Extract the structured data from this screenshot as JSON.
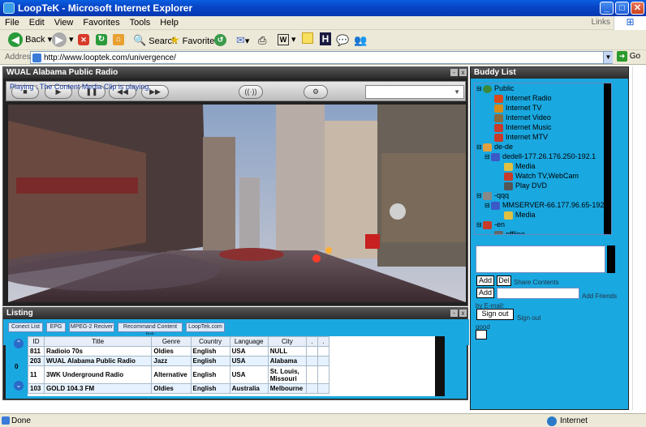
{
  "window": {
    "title": "LoopTeK - Microsoft Internet Explorer"
  },
  "menu": [
    "File",
    "Edit",
    "View",
    "Favorites",
    "Tools",
    "Help"
  ],
  "menu_links": "Links",
  "toolbar": {
    "back": "Back",
    "search": "Search",
    "favorites": "Favorites"
  },
  "address": {
    "label": "Address",
    "url": "http://www.looptek.com/univergence/",
    "go": "Go"
  },
  "player": {
    "title": "WUAL Alabama Public Radio",
    "status_text": "Playing : The Content Media Clip is playing."
  },
  "listing": {
    "title": "Listing",
    "tabs": [
      "Conect List",
      "EPG",
      "MPEG-2 Reciver",
      "Recommand Content link",
      "LoopTek.com"
    ],
    "page_indicator": "0",
    "columns": [
      "ID",
      "Title",
      "Genre",
      "Country",
      "Language",
      "City",
      ".",
      "."
    ],
    "rows": [
      [
        "811",
        "Radioio 70s",
        "Oldies",
        "English",
        "USA",
        "NULL"
      ],
      [
        "203",
        "WUAL Alabama Public Radio",
        "Jazz",
        "English",
        "USA",
        "Alabama"
      ],
      [
        "11",
        "3WK Underground Radio",
        "Alternative",
        "English",
        "USA",
        "St. Louis, Missouri"
      ],
      [
        "103",
        "GOLD 104.3 FM",
        "Oldies",
        "English",
        "Australia",
        "Melbourne"
      ]
    ]
  },
  "buddy": {
    "title": "Buddy List",
    "tree": {
      "public": "Public",
      "public_items": [
        "Internet Radio",
        "Internet TV",
        "Internet Video",
        "Internet Music",
        "Internet MTV"
      ],
      "dede": "de-de",
      "dede_host": "dedell-177.26.176.250-192.1",
      "dede_items": [
        "Media",
        "Watch TV,WebCam",
        "Play DVD"
      ],
      "qqq": "-qqq",
      "qqq_host": "MMSERVER-66.177.96.65-192",
      "qqq_items": [
        "Media"
      ],
      "en": "-en",
      "offline": "offline"
    },
    "add": "Add",
    "del": "Del",
    "share_contents": "Share Contents",
    "add2": "Add",
    "add_friends": "Add Friends",
    "by_email": "by E-mail:",
    "sign_out_btn": "Sign out",
    "sign_out_label": "Sign out",
    "status_word": "good"
  },
  "statusbar": {
    "left": "Done",
    "zone": "Internet"
  },
  "colors": {
    "buddy_bg": "#1aa8e0",
    "panel_border": "#222222",
    "titlebar": "#0846c8"
  }
}
